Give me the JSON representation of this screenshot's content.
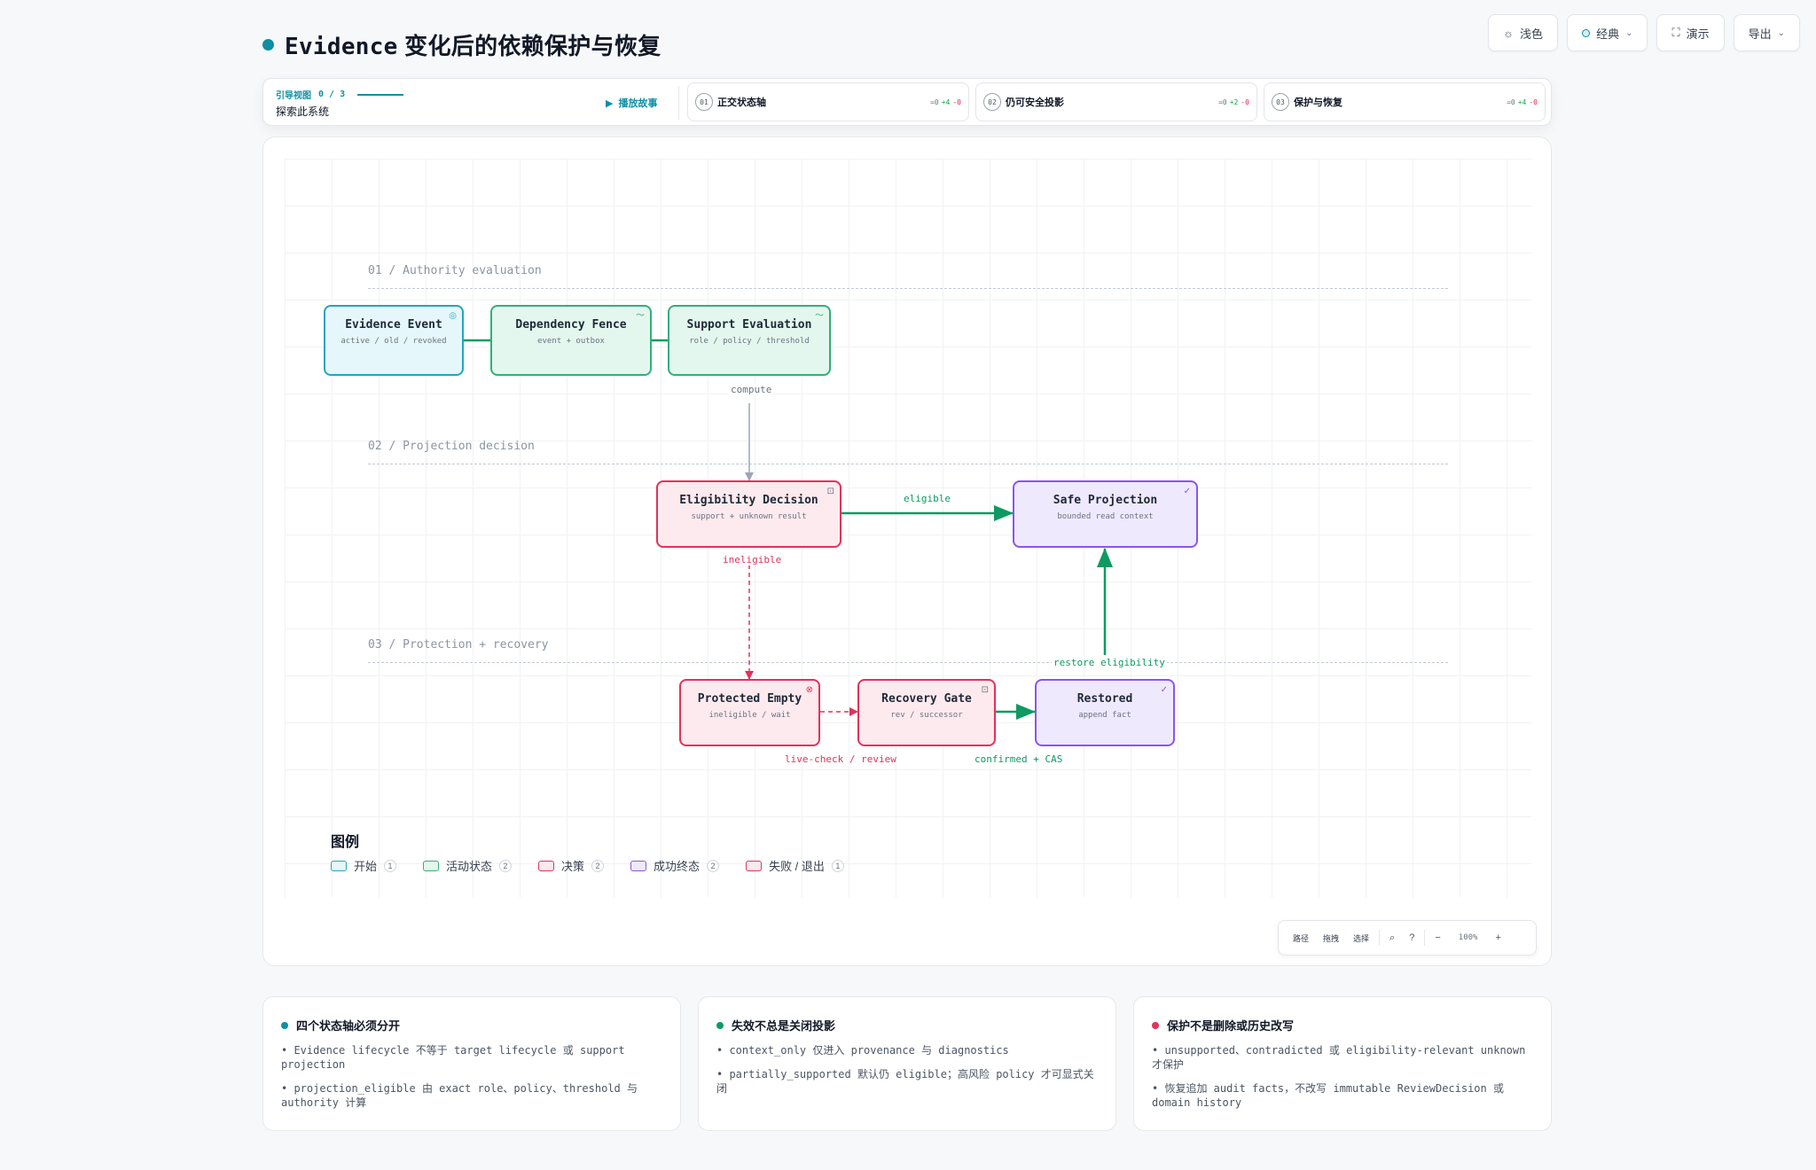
{
  "page": {
    "title_prefix": "Evidence",
    "title_rest": "变化后的依赖保护与恢复",
    "accent": "#0e8fa3"
  },
  "toolbar": {
    "theme_label": "浅色",
    "layout_label": "经典",
    "present_label": "演示",
    "export_label": "导出",
    "icons": [
      "sun-icon",
      "layout-dot-icon",
      "fullscreen-icon",
      "chevron-down-icon"
    ]
  },
  "guide": {
    "mode_label": "引导视图",
    "progress": "0 / 3",
    "subtitle": "探索此系统",
    "play_label": "播放故事",
    "steps": [
      {
        "num": "01",
        "label": "正交状态轴",
        "eq": "=0",
        "plus": "+4",
        "minus": "-0"
      },
      {
        "num": "02",
        "label": "仍可安全投影",
        "eq": "=0",
        "plus": "+2",
        "minus": "-0"
      },
      {
        "num": "03",
        "label": "保护与恢复",
        "eq": "=0",
        "plus": "+4",
        "minus": "-0"
      }
    ]
  },
  "diagram": {
    "lanes": [
      {
        "label": "01 / Authority evaluation"
      },
      {
        "label": "02 / Projection decision"
      },
      {
        "label": "03 / Protection + recovery"
      }
    ],
    "nodes": [
      {
        "id": "evidence",
        "title": "Evidence Event",
        "sub": "active / old / revoked",
        "kind": "start",
        "icon": "target-icon"
      },
      {
        "id": "fence",
        "title": "Dependency Fence",
        "sub": "event + outbox",
        "kind": "active",
        "icon": "pulse-icon"
      },
      {
        "id": "support",
        "title": "Support Evaluation",
        "sub": "role / policy / threshold",
        "kind": "active",
        "icon": "pulse-icon"
      },
      {
        "id": "eligibility",
        "title": "Eligibility Decision",
        "sub": "support + unknown result",
        "kind": "decision",
        "icon": "square-icon"
      },
      {
        "id": "safe",
        "title": "Safe Projection",
        "sub": "bounded read context",
        "kind": "success",
        "icon": "check-circle-icon"
      },
      {
        "id": "protected",
        "title": "Protected Empty",
        "sub": "ineligible / wait",
        "kind": "fail",
        "icon": "x-circle-icon"
      },
      {
        "id": "gate",
        "title": "Recovery Gate",
        "sub": "rev / successor",
        "kind": "decision",
        "icon": "square-icon"
      },
      {
        "id": "restored",
        "title": "Restored",
        "sub": "append fact",
        "kind": "success",
        "icon": "check-circle-icon"
      }
    ],
    "edge_labels": {
      "compute": "compute",
      "eligible": "eligible",
      "ineligible": "ineligible",
      "restore": "restore eligibility",
      "livecheck": "live-check / review",
      "confirmed": "confirmed + CAS"
    },
    "colors": {
      "start": "#22a5c0",
      "active": "#2fb07a",
      "decision": "#e0335a",
      "success": "#8b55e8",
      "edge_green": "#0e9a62",
      "edge_gray": "#9aa6b6",
      "edge_red": "#e0335a"
    }
  },
  "legend": {
    "title": "图例",
    "items": [
      {
        "label": "开始",
        "count": "1"
      },
      {
        "label": "活动状态",
        "count": "2"
      },
      {
        "label": "决策",
        "count": "2"
      },
      {
        "label": "成功终态",
        "count": "2"
      },
      {
        "label": "失败 / 退出",
        "count": "1"
      }
    ]
  },
  "zoom": {
    "path_label": "路径",
    "lock_label": "拖拽",
    "select_label": "选择",
    "minus": "−",
    "value": "100%",
    "plus": "+"
  },
  "cards": [
    {
      "title": "四个状态轴必须分开",
      "dot": "#0e8fa3",
      "items": [
        "• Evidence lifecycle 不等于 target lifecycle 或 support projection",
        "• projection_eligible 由 exact role、policy、threshold 与 authority 计算"
      ]
    },
    {
      "title": "失效不总是关闭投影",
      "dot": "#0e9a62",
      "items": [
        "• context_only 仅进入 provenance 与 diagnostics",
        "• partially_supported 默认仍 eligible；高风险 policy 才可显式关闭"
      ]
    },
    {
      "title": "保护不是删除或历史改写",
      "dot": "#e0335a",
      "items": [
        "• unsupported、contradicted 或 eligibility-relevant unknown 才保护",
        "• 恢复追加 audit facts，不改写 immutable ReviewDecision 或 domain history"
      ]
    }
  ]
}
